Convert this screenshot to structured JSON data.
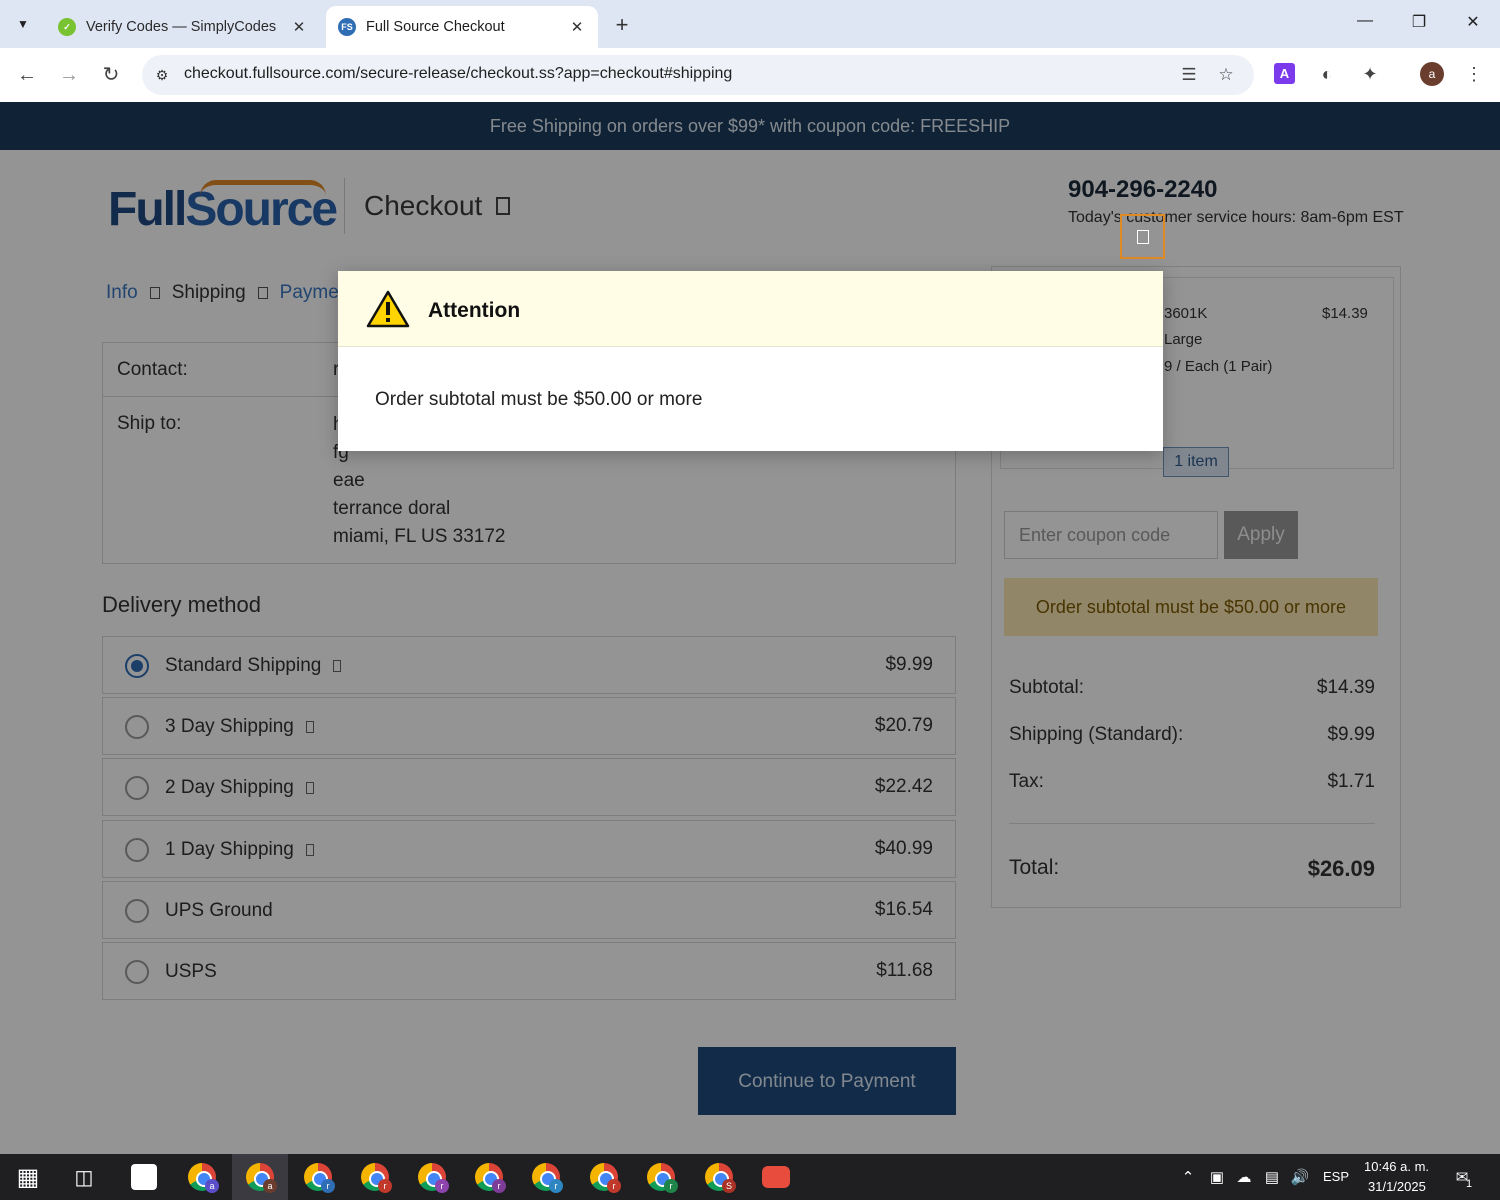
{
  "browser": {
    "tabs": [
      {
        "title": "Verify Codes — SimplyCodes",
        "active": false
      },
      {
        "title": "Full Source Checkout",
        "active": true
      }
    ],
    "url": "checkout.fullsource.com/secure-release/checkout.ss?app=checkout#shipping"
  },
  "banner": {
    "text": "Free Shipping on orders over $99* with coupon code: FREESHIP"
  },
  "header": {
    "logo_full": "Full",
    "logo_source": "Source",
    "title": "Checkout",
    "phone": "904-296-2240",
    "hours": "Today's customer service hours: 8am-6pm EST"
  },
  "breadcrumb": {
    "info": "Info",
    "shipping": "Shipping",
    "payment": "Payme"
  },
  "contact": {
    "label": "Contact:",
    "value": "r"
  },
  "ship_to": {
    "label": "Ship to:",
    "lines": [
      "h",
      "fg",
      "eae",
      "terrance doral",
      "miami, FL US 33172"
    ]
  },
  "delivery": {
    "title": "Delivery method",
    "options": [
      {
        "name": "Standard Shipping",
        "price": "$9.99",
        "selected": true,
        "info": true
      },
      {
        "name": "3 Day Shipping",
        "price": "$20.79",
        "selected": false,
        "info": true
      },
      {
        "name": "2 Day Shipping",
        "price": "$22.42",
        "selected": false,
        "info": true
      },
      {
        "name": "1 Day Shipping",
        "price": "$40.99",
        "selected": false,
        "info": true
      },
      {
        "name": "UPS Ground",
        "price": "$16.54",
        "selected": false,
        "info": false
      },
      {
        "name": "USPS",
        "price": "$11.68",
        "selected": false,
        "info": false
      }
    ],
    "continue_label": "Continue to Payment"
  },
  "summary": {
    "item": {
      "sku": "3601K",
      "price": "$14.39",
      "size": "Large",
      "unit": "9 / Each (1 Pair)"
    },
    "item_count": "1 item",
    "coupon_placeholder": "Enter coupon code",
    "apply_label": "Apply",
    "alert": "Order subtotal must be $50.00 or more",
    "subtotal_label": "Subtotal:",
    "subtotal": "$14.39",
    "shipping_label": "Shipping (Standard):",
    "shipping": "$9.99",
    "tax_label": "Tax:",
    "tax": "$1.71",
    "total_label": "Total:",
    "total": "$26.09"
  },
  "modal": {
    "title": "Attention",
    "message": "Order subtotal must be $50.00 or more"
  },
  "taskbar": {
    "lang": "ESP",
    "time": "10:46 a. m.",
    "date": "31/1/2025",
    "notifications": "1",
    "chrome_badges": [
      "a",
      "a",
      "r",
      "r",
      "r",
      "r",
      "r",
      "r",
      "r",
      "S"
    ]
  },
  "colors": {
    "banner": "#1d3c5c",
    "accent": "#2f6db5",
    "logo_orange": "#e08a26",
    "alert_bg": "#fbe7b6"
  }
}
